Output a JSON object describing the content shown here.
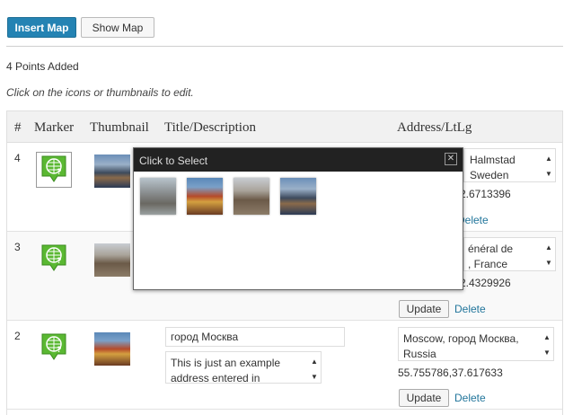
{
  "toolbar": {
    "insert_label": "Insert Map",
    "show_label": "Show Map"
  },
  "points_count": "4 Points Added",
  "hint": "Click on the icons or thumbnails to edit.",
  "table": {
    "headers": {
      "num": "#",
      "marker": "Marker",
      "thumbnail": "Thumbnail",
      "title": "Title/Description",
      "address": "Address/LtLg"
    },
    "rows": [
      {
        "num": "4",
        "address": "Halmstad\nSweden",
        "latlng": "2.6713396"
      },
      {
        "num": "3",
        "address": "énéral de\n, France",
        "latlng": "2.4329926",
        "update": "Update",
        "delete": "Delete"
      },
      {
        "num": "2",
        "title": "город Москва",
        "description": "This is just an example address entered in",
        "address": "Moscow, город Москва, Russia",
        "latlng": "55.755786,37.617633",
        "update": "Update",
        "delete": "Delete"
      }
    ],
    "row0_delete": "Delete"
  },
  "popup": {
    "title": "Click to Select",
    "close": "✕"
  },
  "colors": {
    "accent": "#2483b3",
    "marker_green": "#5ab832",
    "link": "#21759b"
  }
}
